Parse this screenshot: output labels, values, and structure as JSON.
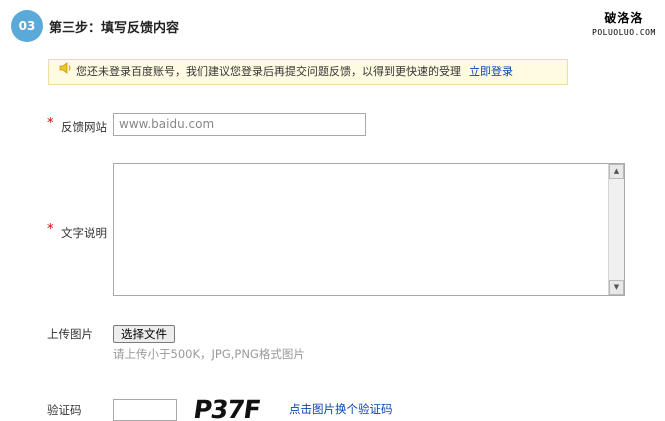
{
  "header": {
    "step_number": "03",
    "step_title": "第三步：填写反馈内容",
    "watermark_cn": "破洛洛",
    "watermark_en": "POLUOLUO.COM"
  },
  "notice": {
    "icon": "speaker-icon",
    "text": "您还未登录百度账号，我们建议您登录后再提交问题反馈，以得到更快速的受理",
    "login_link": "立即登录"
  },
  "form": {
    "required_mark": "*",
    "url_label": "反馈网站",
    "url_value": "www.baidu.com",
    "desc_label": "文字说明",
    "desc_value": "",
    "upload_label": "上传图片",
    "file_button": "选择文件",
    "upload_hint": "请上传小于500K，JPG,PNG格式图片",
    "captcha_label": "验证码",
    "captcha_value": "",
    "captcha_text": "P37F",
    "captcha_refresh": "点击图片换个验证码"
  },
  "colors": {
    "accent": "#5aa9d9",
    "notice_bg": "#fffbe3",
    "link": "#0645ad",
    "required": "#cc0000"
  }
}
